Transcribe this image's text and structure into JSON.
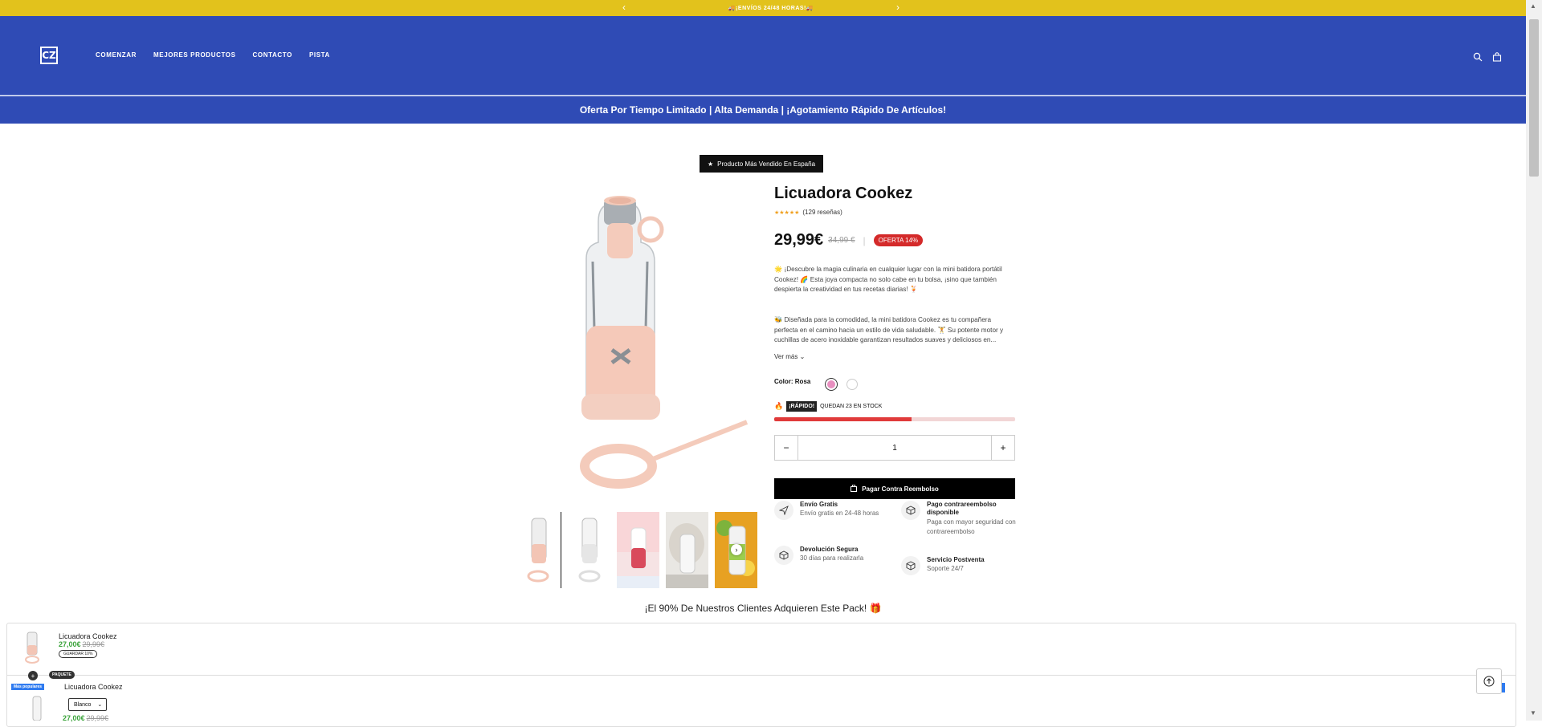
{
  "announcement": {
    "text": "🚚¡ENVÍOS 24/48 HORAS!🚚",
    "prev": "‹",
    "next": "›"
  },
  "header": {
    "logo": "CZ",
    "nav": [
      "COMENZAR",
      "MEJORES PRODUCTOS",
      "CONTACTO",
      "PISTA"
    ],
    "icons": [
      "search-icon",
      "bag-icon"
    ]
  },
  "promo": {
    "text": "Oferta Por Tiempo Limitado | Alta Demanda | ¡Agotamiento Rápido De Artículos!"
  },
  "badge": {
    "text": "Producto Más Vendido En España"
  },
  "product": {
    "title": "Licuadora Cookez",
    "stars": "★★★★★",
    "reviews": "(129 reseñas)",
    "price": "29,99€",
    "old_price": "34,99 €",
    "sale": "OFERTA 14%",
    "desc1": "🌟 ¡Descubre la magia culinaria en cualquier lugar con la mini batidora portátil Cookez! 🌈 Esta joya compacta no solo cabe en tu bolsa, ¡sino que también despierta la creatividad en tus recetas diarias! 🍹",
    "desc2": "🐝 Diseñada para la comodidad, la mini batidora Cookez es tu compañera perfecta en el camino hacia un estilo de vida saludable. 🏋 Su potente motor y cuchillas de acero inoxidable garantizan resultados suaves y deliciosos en...",
    "see_more": "Ver más",
    "color_label": "Color: Rosa",
    "colors": [
      "#e88fc0",
      "#ffffff"
    ],
    "stock_tag": "¡RÁPIDO!",
    "stock_text": "QUEDAN 23 EN STOCK",
    "stock_level": 0.57,
    "quantity": "1",
    "minus": "−",
    "plus": "+",
    "buy_label": "Pagar Contra Reembolso"
  },
  "features": [
    {
      "title": "Envío Gratis",
      "sub": "Envío gratis en 24-48 horas",
      "icon": "plane-icon"
    },
    {
      "title": "Pago contrareembolso disponible",
      "sub": "Paga con mayor seguridad con contrareembolso",
      "icon": "box-icon"
    },
    {
      "title": "Devolución Segura",
      "sub": "30 días para realizarla",
      "icon": "box-icon"
    },
    {
      "title": "Servicio Postventa",
      "sub": "Soporte 24/7",
      "icon": "box-icon"
    }
  ],
  "bundle": {
    "title": "¡El 90% De Nuestros Clientes Adquieren Este Pack! 🎁",
    "item1": {
      "name": "Licuadora Cookez",
      "price": "27,00€",
      "old": "29,99€",
      "save": "GUARDAR 10%"
    },
    "plus": "+",
    "package": "PAQUETE",
    "popular": "Más populares",
    "item2": {
      "name": "Licuadora Cookez",
      "select": "Blanco",
      "price": "27,00€",
      "old": "29,99€"
    }
  }
}
